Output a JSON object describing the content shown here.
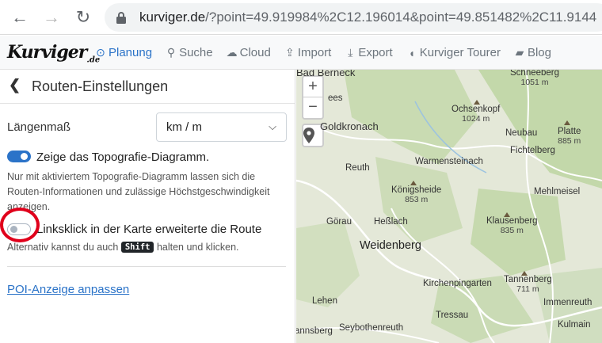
{
  "browser": {
    "url_host": "kurviger.de",
    "url_rest": "/?point=49.919984%2C12.196014&point=49.851482%2C11.9144"
  },
  "app": {
    "logo": "Kurviger",
    "logo_suffix": ".de",
    "menu": [
      {
        "label": "Planung",
        "icon": "compass-icon"
      },
      {
        "label": "Suche",
        "icon": "search-icon"
      },
      {
        "label": "Cloud",
        "icon": "cloud-icon"
      },
      {
        "label": "Import",
        "icon": "upload-icon"
      },
      {
        "label": "Export",
        "icon": "download-icon"
      },
      {
        "label": "Kurviger Tourer",
        "icon": "kurviger-icon"
      },
      {
        "label": "Blog",
        "icon": "book-icon"
      }
    ],
    "accent": "#2b73c8"
  },
  "sidebar": {
    "title": "Routen-Einstellungen",
    "unit_label": "Längenmaß",
    "unit_value": "km / m",
    "topo_toggle": {
      "label": "Zeige das Topografie-Diagramm.",
      "on": true
    },
    "topo_help": "Nur mit aktiviertem Topografie-Diagramm lassen sich die Routen-Informationen und zulässige Höchstgeschwindigkeit anzeigen.",
    "leftclick_toggle": {
      "label": "Linksklick in der Karte erweiterte die Route",
      "on": false
    },
    "leftclick_help_pre": "Alternativ kannst du auch",
    "leftclick_help_key": "Shift",
    "leftclick_help_post": "halten und klicken.",
    "poi_link": "POI-Anzeige anpassen",
    "highlight_color": "#e0001b"
  },
  "map": {
    "zoom_in": "+",
    "zoom_out": "−",
    "places": [
      {
        "name": "Bad Berneck"
      },
      {
        "name": "Schneeberg",
        "elev": "1051 m"
      },
      {
        "name": "Ochsenkopf",
        "elev": "1024 m"
      },
      {
        "name": "Goldkronach"
      },
      {
        "name": "Neubau"
      },
      {
        "name": "Platte",
        "elev": "885 m"
      },
      {
        "name": "Fichtelberg"
      },
      {
        "name": "Warmensteinach"
      },
      {
        "name": "Reuth"
      },
      {
        "name": "Königsheide",
        "elev": "853 m"
      },
      {
        "name": "Mehlmeisel"
      },
      {
        "name": "Görau"
      },
      {
        "name": "Heßlach"
      },
      {
        "name": "Klausenberg",
        "elev": "835 m"
      },
      {
        "name": "Weidenberg"
      },
      {
        "name": "Kirchenpingarten"
      },
      {
        "name": "Tannenberg",
        "elev": "711 m"
      },
      {
        "name": "Immenreuth"
      },
      {
        "name": "Lehen"
      },
      {
        "name": "Tressau"
      },
      {
        "name": "annsberg"
      },
      {
        "name": "Seybothenreuth"
      },
      {
        "name": "Kulmain"
      },
      {
        "name": "ees"
      }
    ]
  }
}
